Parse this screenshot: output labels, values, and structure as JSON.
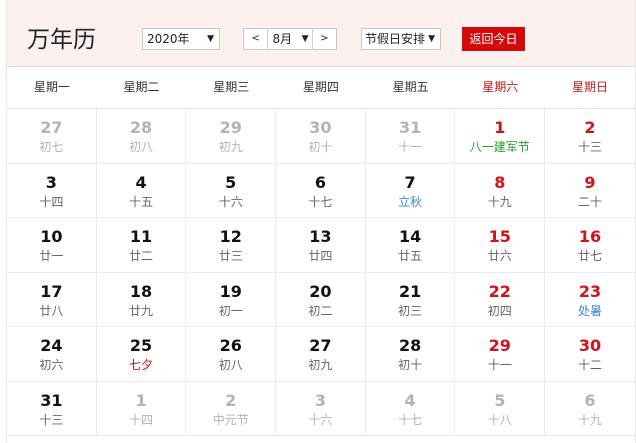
{
  "header": {
    "title": "万年历",
    "year_select": "2020年",
    "month_prev": "<",
    "month_select": "8月",
    "month_next": ">",
    "holiday_select": "节假日安排",
    "today_button": "返回今日",
    "dropdown_arrow": "▼"
  },
  "weekdays": [
    {
      "label": "星期一",
      "weekend": false
    },
    {
      "label": "星期二",
      "weekend": false
    },
    {
      "label": "星期三",
      "weekend": false
    },
    {
      "label": "星期四",
      "weekend": false
    },
    {
      "label": "星期五",
      "weekend": false
    },
    {
      "label": "星期六",
      "weekend": true
    },
    {
      "label": "星期日",
      "weekend": true
    }
  ],
  "weeks": [
    [
      {
        "day": "27",
        "lunar": "初七",
        "type": "other"
      },
      {
        "day": "28",
        "lunar": "初八",
        "type": "other"
      },
      {
        "day": "29",
        "lunar": "初九",
        "type": "other"
      },
      {
        "day": "30",
        "lunar": "初十",
        "type": "other"
      },
      {
        "day": "31",
        "lunar": "十一",
        "type": "other"
      },
      {
        "day": "1",
        "lunar": "八一建军节",
        "type": "weekend",
        "mark": "festival"
      },
      {
        "day": "2",
        "lunar": "十三",
        "type": "weekend"
      }
    ],
    [
      {
        "day": "3",
        "lunar": "十四",
        "type": "normal"
      },
      {
        "day": "4",
        "lunar": "十五",
        "type": "normal"
      },
      {
        "day": "5",
        "lunar": "十六",
        "type": "normal"
      },
      {
        "day": "6",
        "lunar": "十七",
        "type": "normal"
      },
      {
        "day": "7",
        "lunar": "立秋",
        "type": "normal",
        "mark": "term"
      },
      {
        "day": "8",
        "lunar": "十九",
        "type": "weekend"
      },
      {
        "day": "9",
        "lunar": "二十",
        "type": "weekend"
      }
    ],
    [
      {
        "day": "10",
        "lunar": "廿一",
        "type": "normal"
      },
      {
        "day": "11",
        "lunar": "廿二",
        "type": "normal"
      },
      {
        "day": "12",
        "lunar": "廿三",
        "type": "normal"
      },
      {
        "day": "13",
        "lunar": "廿四",
        "type": "normal"
      },
      {
        "day": "14",
        "lunar": "廿五",
        "type": "normal"
      },
      {
        "day": "15",
        "lunar": "廿六",
        "type": "weekend"
      },
      {
        "day": "16",
        "lunar": "廿七",
        "type": "weekend"
      }
    ],
    [
      {
        "day": "17",
        "lunar": "廿八",
        "type": "normal"
      },
      {
        "day": "18",
        "lunar": "廿九",
        "type": "normal"
      },
      {
        "day": "19",
        "lunar": "初一",
        "type": "normal"
      },
      {
        "day": "20",
        "lunar": "初二",
        "type": "normal"
      },
      {
        "day": "21",
        "lunar": "初三",
        "type": "normal"
      },
      {
        "day": "22",
        "lunar": "初四",
        "type": "weekend"
      },
      {
        "day": "23",
        "lunar": "处暑",
        "type": "weekend",
        "mark": "term"
      }
    ],
    [
      {
        "day": "24",
        "lunar": "初六",
        "type": "normal"
      },
      {
        "day": "25",
        "lunar": "七夕",
        "type": "normal",
        "mark": "holiday"
      },
      {
        "day": "26",
        "lunar": "初八",
        "type": "normal"
      },
      {
        "day": "27",
        "lunar": "初九",
        "type": "normal"
      },
      {
        "day": "28",
        "lunar": "初十",
        "type": "normal"
      },
      {
        "day": "29",
        "lunar": "十一",
        "type": "weekend"
      },
      {
        "day": "30",
        "lunar": "十二",
        "type": "weekend"
      }
    ],
    [
      {
        "day": "31",
        "lunar": "十三",
        "type": "normal"
      },
      {
        "day": "1",
        "lunar": "十四",
        "type": "other"
      },
      {
        "day": "2",
        "lunar": "中元节",
        "type": "other"
      },
      {
        "day": "3",
        "lunar": "十六",
        "type": "other"
      },
      {
        "day": "4",
        "lunar": "十七",
        "type": "other"
      },
      {
        "day": "5",
        "lunar": "十八",
        "type": "other"
      },
      {
        "day": "6",
        "lunar": "十九",
        "type": "other"
      }
    ]
  ],
  "colors": {
    "header_bg": "#fbf2ef",
    "accent_red": "#d40a0a",
    "weekend_red": "#d0121b",
    "festival_green": "#2a9d2a",
    "solar_term_blue": "#3a8bc9",
    "muted_gray": "#b3b3b3"
  }
}
